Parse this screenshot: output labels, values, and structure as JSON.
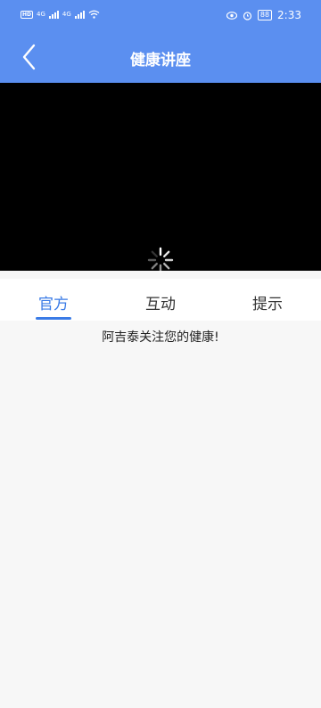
{
  "status_bar": {
    "network_badge_1": "HD",
    "network_badge_2": "HD",
    "signal_label_1": "4G",
    "signal_label_2": "4G",
    "battery": "88",
    "time": "2:33"
  },
  "header": {
    "title": "健康讲座"
  },
  "video": {
    "state": "loading"
  },
  "tabs": [
    {
      "label": "官方",
      "active": true
    },
    {
      "label": "互动",
      "active": false
    },
    {
      "label": "提示",
      "active": false
    }
  ],
  "content": {
    "message": "阿吉泰关注您的健康!"
  },
  "colors": {
    "header": "#5b8ff0",
    "accent": "#3a7be6",
    "video_bg": "#000000"
  }
}
